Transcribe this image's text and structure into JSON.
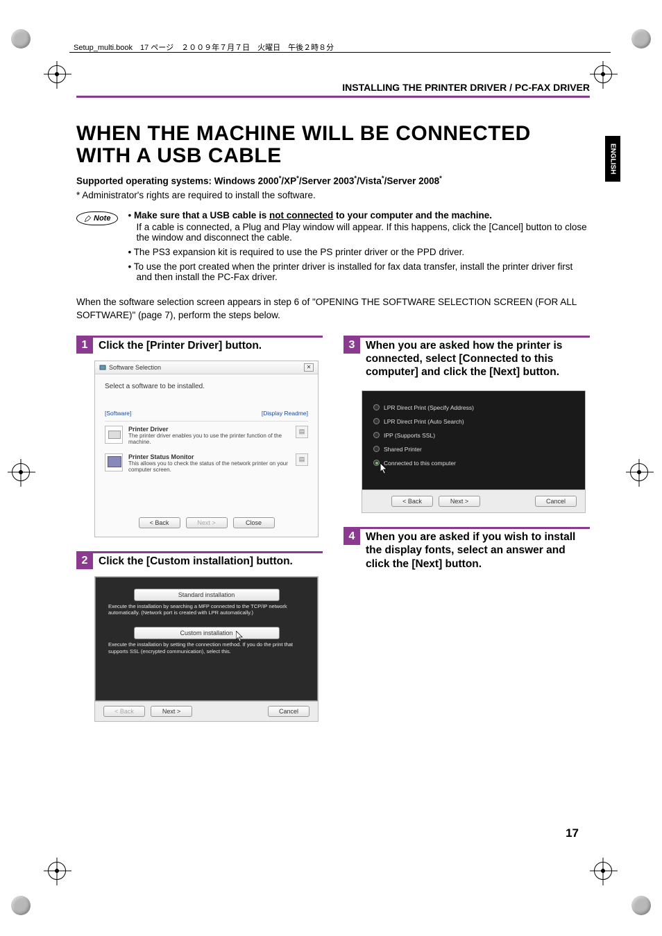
{
  "header_marker": "Setup_multi.book　17 ページ　２００９年７月７日　火曜日　午後２時８分",
  "section_header": "INSTALLING THE PRINTER DRIVER / PC-FAX DRIVER",
  "side_tab": "ENGLISH",
  "title": "WHEN THE MACHINE WILL BE CONNECTED WITH A USB CABLE",
  "subhead_prefix": "Supported operating systems: Windows 2000",
  "subhead_mid1": "/XP",
  "subhead_mid2": "/Server 2003",
  "subhead_mid3": "/Vista",
  "subhead_mid4": "/Server 2008",
  "asterisk": "*",
  "admin_note": "* Administrator's rights are required to install the software.",
  "note_label": "Note",
  "bullets": {
    "b1_bold": "Make sure that a USB cable is ",
    "b1_u": "not connected",
    "b1_rest": " to your computer and the machine.",
    "b1_sub": "If a cable is connected, a Plug and Play window will appear. If this happens, click the [Cancel] button to close the window and disconnect the cable.",
    "b2": "The PS3 expansion kit is required to use the PS printer driver or the PPD driver.",
    "b3": "To use the port created when the printer driver is installed for fax data transfer, install the printer driver first and then install the PC-Fax driver."
  },
  "intro": "When the software selection screen appears in step 6 of \"OPENING THE SOFTWARE SELECTION SCREEN (FOR ALL SOFTWARE)\" (page 7), perform the steps below.",
  "steps": {
    "s1": {
      "num": "1",
      "title": "Click the [Printer Driver] button."
    },
    "s2": {
      "num": "2",
      "title": "Click the [Custom installation] button."
    },
    "s3": {
      "num": "3",
      "title": "When you are asked how the printer is connected, select [Connected to this computer] and click the [Next] button."
    },
    "s4": {
      "num": "4",
      "title": "When you are asked if you wish to install the display fonts, select an answer and click the [Next] button."
    }
  },
  "dialog1": {
    "title": "Software Selection",
    "prompt": "Select a software to be installed.",
    "link_software": "[Software]",
    "link_readme": "[Display Readme]",
    "item1_t": "Printer Driver",
    "item1_d": "The printer driver enables you to use the printer function of the machine.",
    "item2_t": "Printer Status Monitor",
    "item2_d": "This allows you to check the status of the network printer on your computer screen.",
    "btn_back": "< Back",
    "btn_next": "Next >",
    "btn_close": "Close"
  },
  "dialog2": {
    "btn_std": "Standard installation",
    "desc_std": "Execute the installation by searching a MFP connected to the TCP/IP network automatically. (Network port is created with LPR automatically.)",
    "btn_cust": "Custom installation",
    "desc_cust": "Execute the installation by setting the connection method. If you do the print that supports SSL (encrypted communication), select this.",
    "btn_back": "< Back",
    "btn_next": "Next >",
    "btn_cancel": "Cancel"
  },
  "dialog3": {
    "r1": "LPR Direct Print (Specify Address)",
    "r2": "LPR Direct Print (Auto Search)",
    "r3": "IPP (Supports SSL)",
    "r4": "Shared Printer",
    "r5": "Connected to this computer",
    "btn_back": "< Back",
    "btn_next": "Next >",
    "btn_cancel": "Cancel"
  },
  "page_num": "17"
}
